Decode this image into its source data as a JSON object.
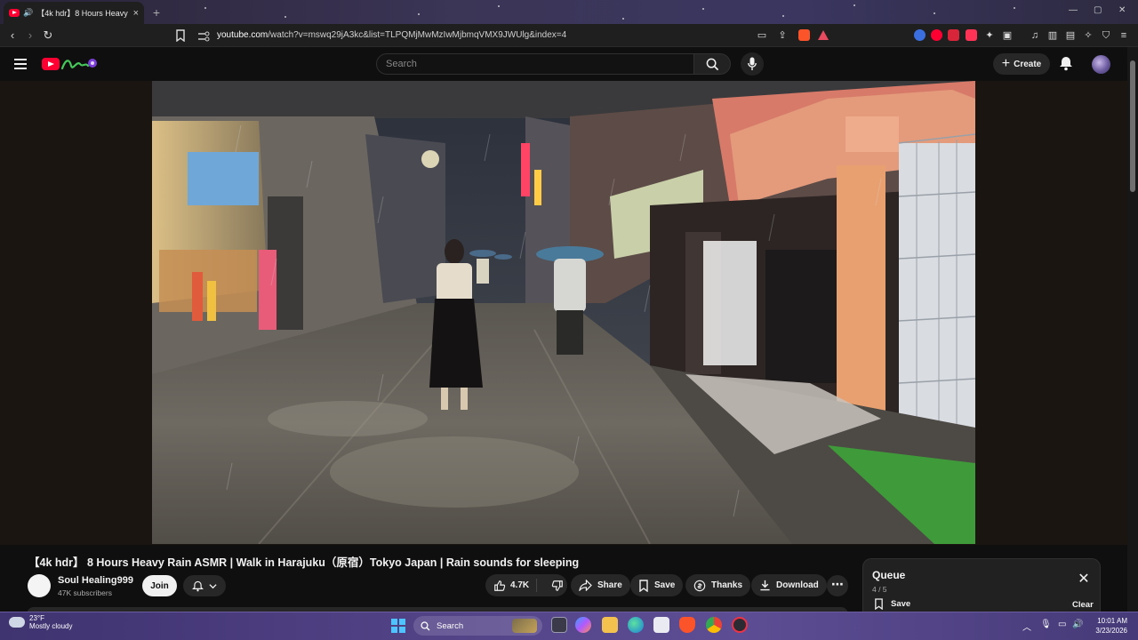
{
  "browser": {
    "tab_title": "【4k hdr】8 Hours Heavy Rain",
    "tab_close": "×",
    "new_tab": "+",
    "url_host": "youtube.com",
    "url_rest": "/watch?v=mswq29jA3kc&list=TLPQMjMwMzIwMjbmqVMX9JWUlg&index=4"
  },
  "masthead": {
    "search_placeholder": "Search",
    "create_label": "Create"
  },
  "video": {
    "title": "【4k hdr】 8 Hours Heavy Rain ASMR | Walk in Harajuku（原宿）Tokyo Japan | Rain sounds for sleeping"
  },
  "channel": {
    "name": "Soul Healing999",
    "subscribers": "47K subscribers",
    "join_label": "Join"
  },
  "actions": {
    "likes": "4.7K",
    "share": "Share",
    "save": "Save",
    "thanks": "Thanks",
    "download": "Download",
    "more": "⋯"
  },
  "queue": {
    "title": "Queue",
    "position": "4 / 5",
    "save_label": "Save",
    "clear_label": "Clear"
  },
  "taskbar": {
    "temperature": "23°F",
    "weather": "Mostly cloudy",
    "search_label": "Search",
    "time": "10:01 AM",
    "date": "3/23/2026"
  },
  "icons": {
    "browser": [
      "back-icon",
      "forward-icon",
      "reload-icon",
      "bookmark-icon",
      "site-info-icon"
    ],
    "youtube": [
      "menu-icon",
      "youtube-logo",
      "search-icon",
      "microphone-icon",
      "plus-icon",
      "bell-icon"
    ],
    "actions": [
      "thumbs-up-icon",
      "thumbs-down-icon",
      "share-icon",
      "save-icon",
      "thanks-icon",
      "download-icon"
    ]
  },
  "colors": {
    "youtube_red": "#ff0033",
    "background": "#0f0f0f",
    "pill": "#272727",
    "taskbar": "#55458a"
  }
}
